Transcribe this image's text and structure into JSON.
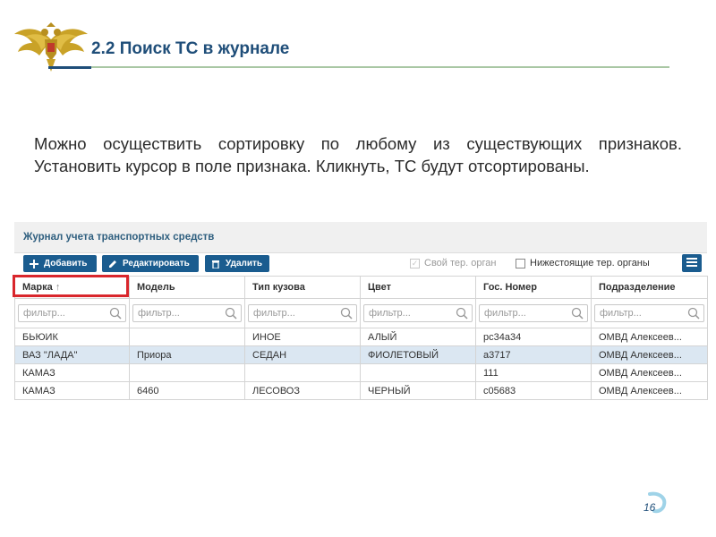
{
  "slide": {
    "title": "2.2 Поиск ТС в журнале",
    "description": "Можно осуществить сортировку по любому из существующих признаков. Установить курсор в поле признака. Кликнуть, ТС будут отсортированы.",
    "page_number": "16",
    "emblem_icon": "double-headed-eagle-icon"
  },
  "journal": {
    "title": "Журнал учета транспортных средств",
    "toolbar": {
      "add_label": "Добавить",
      "edit_label": "Редактировать",
      "delete_label": "Удалить",
      "own_org_label": "Свой тер. орган",
      "own_org_checked": true,
      "own_org_disabled": true,
      "lower_orgs_label": "Нижестоящие тер. органы",
      "lower_orgs_checked": false
    },
    "columns": [
      {
        "label": "Марка",
        "sorted": "asc"
      },
      {
        "label": "Модель"
      },
      {
        "label": "Тип кузова"
      },
      {
        "label": "Цвет"
      },
      {
        "label": "Гос. Номер"
      },
      {
        "label": "Подразделение"
      }
    ],
    "filter_placeholder": "фильтр...",
    "rows": [
      [
        "БЬЮИК",
        "",
        "ИНОЕ",
        "АЛЫЙ",
        "рс34а34",
        "ОМВД Алексеев..."
      ],
      [
        "ВАЗ \"ЛАДА\"",
        "Приора",
        "СЕДАН",
        "ФИОЛЕТОВЫЙ",
        "а3717",
        "ОМВД Алексеев..."
      ],
      [
        "КАМАЗ",
        "",
        "",
        "",
        "111",
        "ОМВД Алексеев..."
      ],
      [
        "КАМАЗ",
        "6460",
        "ЛЕСОВОЗ",
        "ЧЕРНЫЙ",
        "с05683",
        "ОМВД Алексеев..."
      ]
    ],
    "colors": {
      "primary": "#1a5c8f",
      "row_alt": "#dbe7f2",
      "highlight": "#d9262c",
      "title": "#1f4e79"
    }
  }
}
